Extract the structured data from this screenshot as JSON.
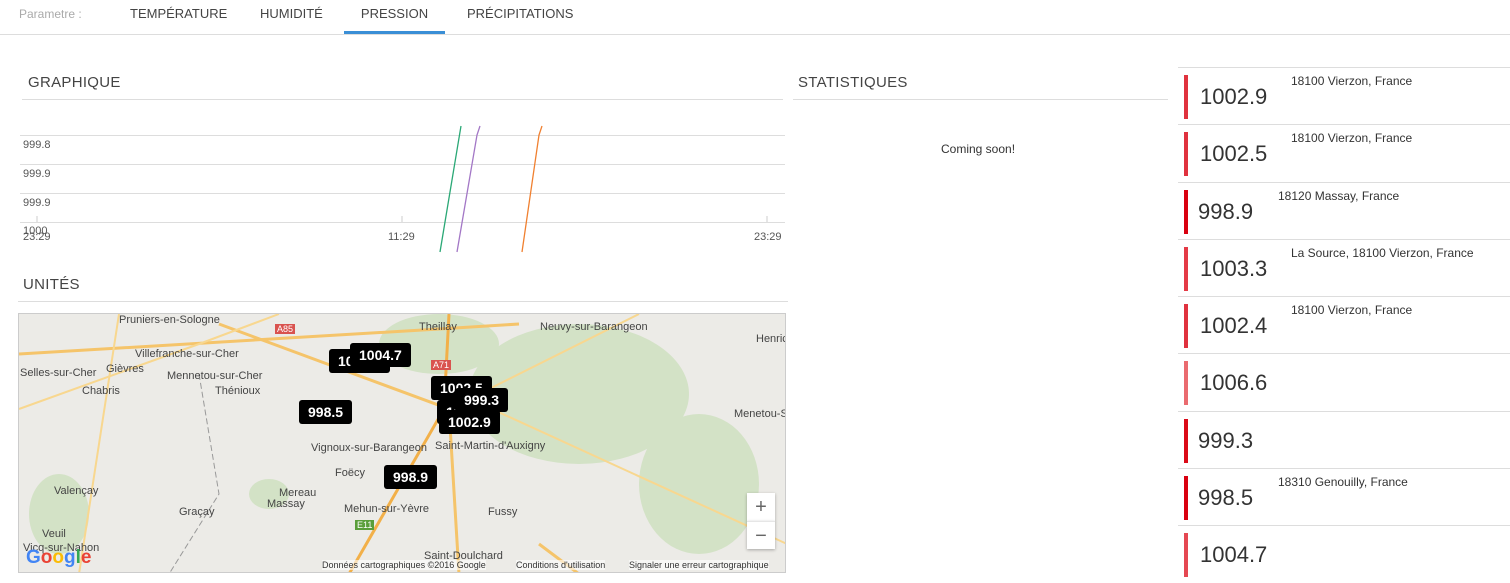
{
  "tabs": {
    "label": "Parametre :",
    "items": [
      "TEMPÉRATURE",
      "HUMIDITÉ",
      "PRESSION",
      "PRÉCIPITATIONS"
    ],
    "active": "PRESSION"
  },
  "graph": {
    "title": "GRAPHIQUE",
    "y_ticks": [
      "999.8",
      "999.9",
      "999.9",
      "1000"
    ],
    "x_ticks": [
      "23:29",
      "11:29",
      "23:29"
    ]
  },
  "chart_data": {
    "type": "line",
    "title": "GRAPHIQUE",
    "y_tick_labels": [
      "999.8",
      "999.9",
      "999.9",
      "1000"
    ],
    "x_tick_labels": [
      "23:29",
      "11:29",
      "23:29"
    ],
    "series": [
      {
        "name": "green",
        "color": "#2aa876"
      },
      {
        "name": "purple",
        "color": "#a377c6"
      },
      {
        "name": "orange",
        "color": "#f08030"
      }
    ]
  },
  "stats": {
    "title": "STATISTIQUES",
    "text": "Coming soon!"
  },
  "units": {
    "title": "UNITÉS"
  },
  "list": [
    {
      "value": "1002.9",
      "address": "18100 Vierzon, France",
      "color": "#e0323e"
    },
    {
      "value": "1002.5",
      "address": "18100 Vierzon, France",
      "color": "#e0323e"
    },
    {
      "value": "998.9",
      "address": "18120 Massay, France",
      "color": "#d90010"
    },
    {
      "value": "1003.3",
      "address": "La Source, 18100 Vierzon, France",
      "color": "#e43a46"
    },
    {
      "value": "1002.4",
      "address": "18100 Vierzon, France",
      "color": "#e0323e"
    },
    {
      "value": "1006.6",
      "address": "",
      "color": "#ea6b6f"
    },
    {
      "value": "999.3",
      "address": "",
      "color": "#db0a18"
    },
    {
      "value": "998.5",
      "address": "18310 Genouilly, France",
      "color": "#d90010"
    },
    {
      "value": "1004.7",
      "address": "",
      "color": "#e54852"
    }
  ],
  "map": {
    "places": [
      "Pruniers-en-Sologne",
      "Theillay",
      "Neuvy-sur-Barangeon",
      "Henric",
      "Villefranche-sur-Cher",
      "Selles-sur-Cher",
      "Gièvres",
      "Mennetou-sur-Cher",
      "Chabris",
      "Thénioux",
      "Menetou-Sa",
      "Vignoux-sur-Barangeon",
      "Saint-Martin-d'Auxigny",
      "Foëcy",
      "Valençay",
      "Mereau",
      "Massay",
      "Graçay",
      "Mehun-sur-Yèvre",
      "Fussy",
      "Veuil",
      "Vicq-sur-Nahon",
      "Saint-Doulchard"
    ],
    "roads": [
      "A85",
      "A71",
      "E11"
    ],
    "markers": [
      "1006.6",
      "1004.7",
      "1002.5",
      "1002.4",
      "1002.9",
      "999.3",
      "998.5",
      "998.9"
    ],
    "zoom_in": "+",
    "zoom_out": "−",
    "logo": "Google",
    "footer": [
      "Données cartographiques ©2016 Google",
      "Conditions d'utilisation",
      "Signaler une erreur cartographique"
    ]
  }
}
